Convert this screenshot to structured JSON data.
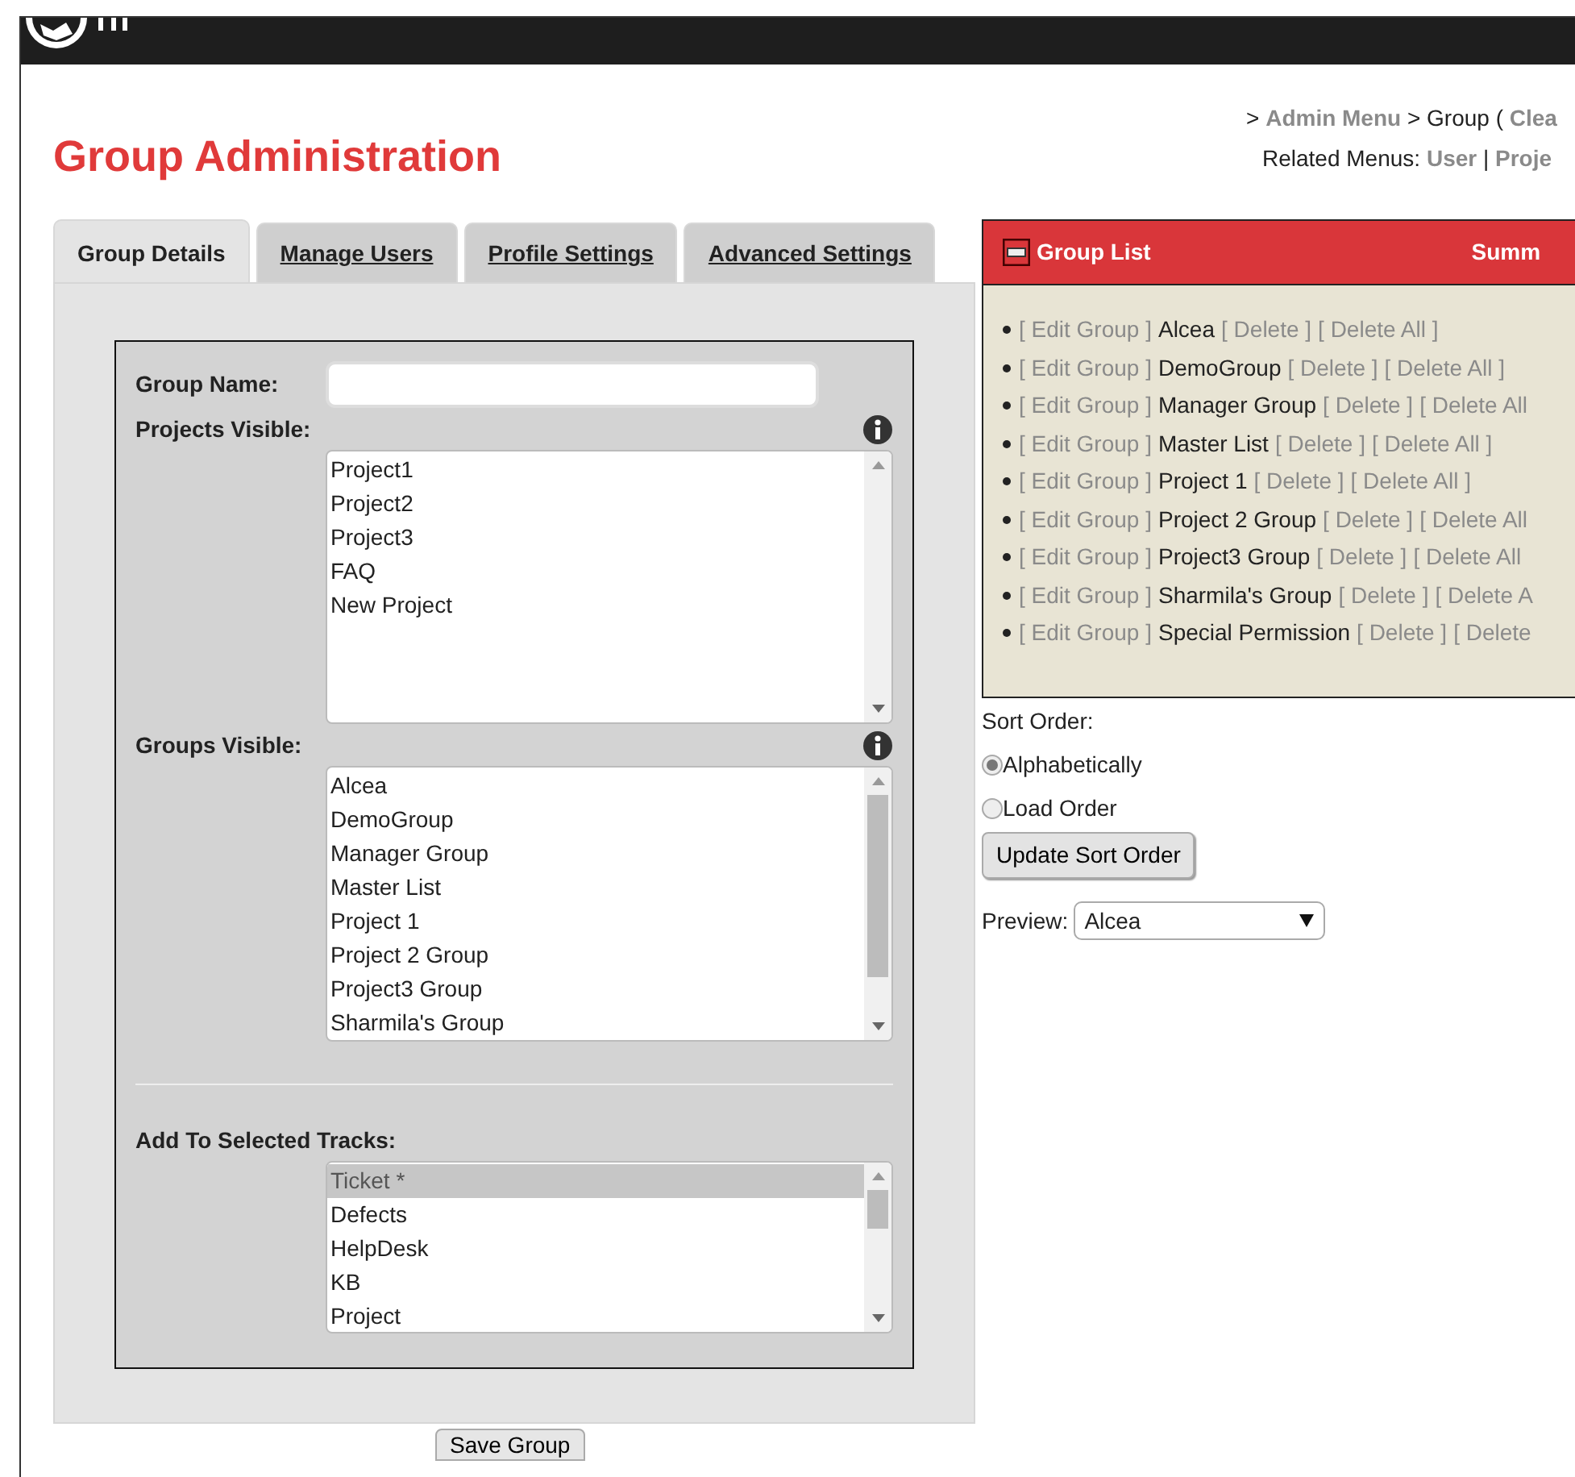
{
  "breadcrumb": {
    "prefix": ">",
    "links": [
      {
        "text": "Admin Menu",
        "kind": "link"
      },
      {
        "text": "> Group (",
        "kind": "text"
      },
      {
        "text": "Clea",
        "kind": "link"
      }
    ]
  },
  "related_menus": {
    "label": "Related Menus:",
    "separator": "|",
    "links": [
      "User",
      "Proje"
    ]
  },
  "title": "Group Administration",
  "tabs": [
    {
      "label": "Group Details",
      "selected": true
    },
    {
      "label": "Manage Users",
      "selected": false
    },
    {
      "label": "Profile Settings",
      "selected": false
    },
    {
      "label": "Advanced Settings",
      "selected": false
    }
  ],
  "form": {
    "group_name": {
      "label": "Group Name:"
    },
    "projects_visible": {
      "label": "Projects Visible:",
      "items": [
        {
          "text": "Project1",
          "selected": false
        },
        {
          "text": "Project2",
          "selected": false
        },
        {
          "text": "Project3",
          "selected": false
        },
        {
          "text": "FAQ",
          "selected": false
        },
        {
          "text": "New Project",
          "selected": false
        }
      ]
    },
    "groups_visible": {
      "label": "Groups Visible:",
      "items": [
        {
          "text": "Alcea",
          "selected": false
        },
        {
          "text": "DemoGroup",
          "selected": false
        },
        {
          "text": "Manager Group",
          "selected": false
        },
        {
          "text": "Master List",
          "selected": false
        },
        {
          "text": "Project 1",
          "selected": false
        },
        {
          "text": "Project 2 Group",
          "selected": false
        },
        {
          "text": "Project3 Group",
          "selected": false
        },
        {
          "text": "Sharmila's Group",
          "selected": false
        }
      ]
    },
    "tracks": {
      "label": "Add To Selected Tracks:",
      "items": [
        {
          "text": "Ticket *",
          "selected": true
        },
        {
          "text": "Defects",
          "selected": false
        },
        {
          "text": "HelpDesk",
          "selected": false
        },
        {
          "text": "KB",
          "selected": false
        },
        {
          "text": "Project",
          "selected": false
        }
      ]
    },
    "save_button": "Save Group"
  },
  "group_list": {
    "title": "Group List",
    "summary": "Summ",
    "items": [
      {
        "edit": "[ Edit Group ]",
        "name": "Alcea",
        "delete": "[ Delete ]",
        "delete_all": "[ Delete All ]"
      },
      {
        "edit": "[ Edit Group ]",
        "name": "DemoGroup",
        "delete": "[ Delete ]",
        "delete_all": "[ Delete All ]"
      },
      {
        "edit": "[ Edit Group ]",
        "name": "Manager Group",
        "delete": "[ Delete ]",
        "delete_all": "[ Delete All"
      },
      {
        "edit": "[ Edit Group ]",
        "name": "Master List",
        "delete": "[ Delete ]",
        "delete_all": "[ Delete All ]"
      },
      {
        "edit": "[ Edit Group ]",
        "name": "Project 1",
        "delete": "[ Delete ]",
        "delete_all": "[ Delete All ]"
      },
      {
        "edit": "[ Edit Group ]",
        "name": "Project 2 Group",
        "delete": "[ Delete ]",
        "delete_all": "[ Delete All"
      },
      {
        "edit": "[ Edit Group ]",
        "name": "Project3 Group",
        "delete": "[ Delete ]",
        "delete_all": "[ Delete All"
      },
      {
        "edit": "[ Edit Group ]",
        "name": "Sharmila's Group",
        "delete": "[ Delete ]",
        "delete_all": "[ Delete A"
      },
      {
        "edit": "[ Edit Group ]",
        "name": "Special Permission",
        "delete": "[ Delete ]",
        "delete_all": "[ Delete"
      }
    ]
  },
  "sort_order": {
    "label": "Sort Order:",
    "options": [
      {
        "label": "Alphabetically",
        "selected": true
      },
      {
        "label": "Load Order",
        "selected": false
      }
    ],
    "button": "Update Sort Order"
  },
  "preview": {
    "label": "Preview:",
    "value": "Alcea"
  }
}
